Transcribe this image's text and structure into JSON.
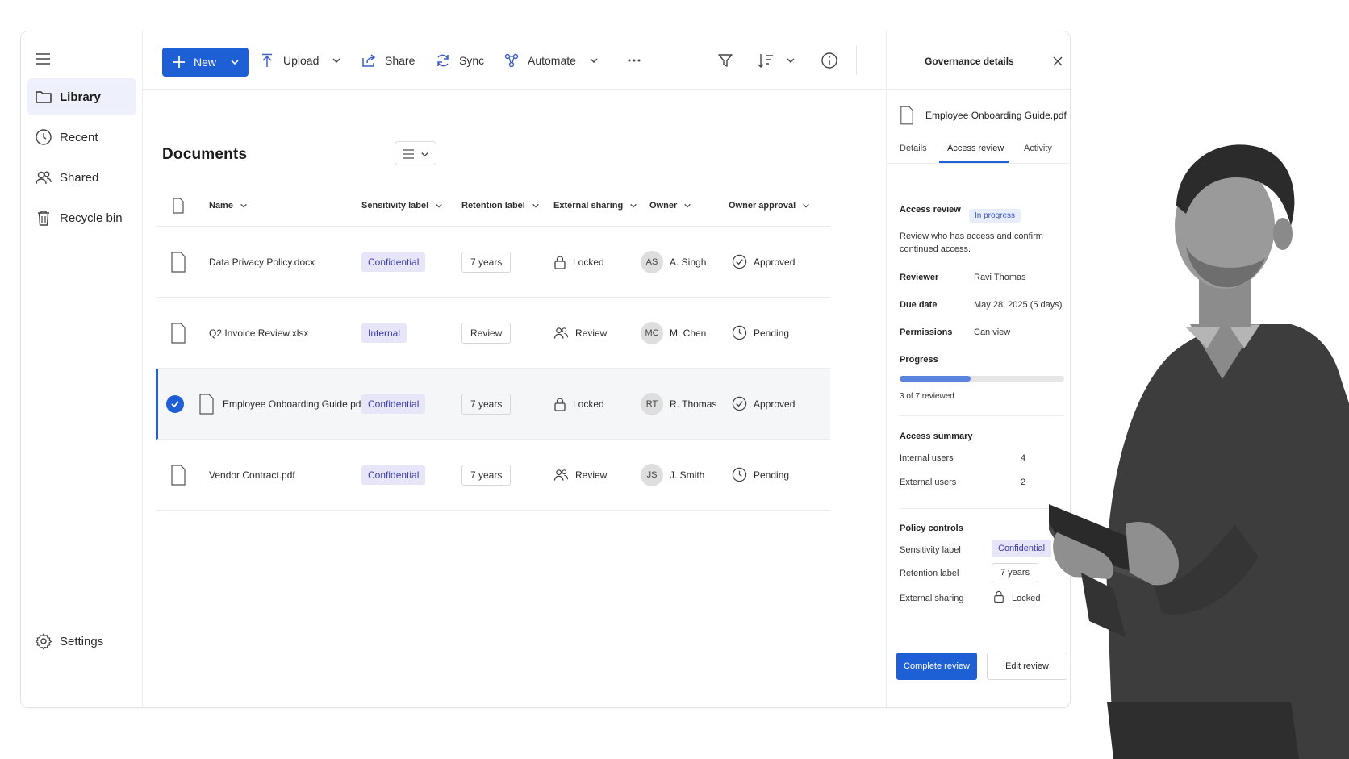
{
  "sidebar": {
    "items": [
      {
        "label": "Library",
        "icon": "folder-icon"
      },
      {
        "label": "Recent",
        "icon": "clock-icon"
      },
      {
        "label": "Shared",
        "icon": "people-icon"
      },
      {
        "label": "Recycle bin",
        "icon": "trash-icon"
      }
    ],
    "settings_label": "Settings"
  },
  "toolbar": {
    "new_label": "New",
    "upload_label": "Upload",
    "share_label": "Share",
    "sync_label": "Sync",
    "automate_label": "Automate"
  },
  "main": {
    "title": "Documents",
    "columns": [
      "Name",
      "Sensitivity label",
      "Retention label",
      "External sharing",
      "Owner",
      "Owner approval"
    ],
    "rows": [
      {
        "name": "Data Privacy Policy.docx",
        "sensitivity": "Confidential",
        "retention": "7 years",
        "sharing": "Locked",
        "owner_initials": "AS",
        "owner": "A. Singh",
        "approval": "Approved",
        "selected": false
      },
      {
        "name": "Q2 Invoice Review.xlsx",
        "sensitivity": "Internal",
        "retention": "Review",
        "sharing": "Review",
        "owner_initials": "MC",
        "owner": "M. Chen",
        "approval": "Pending",
        "selected": false
      },
      {
        "name": "Employee Onboarding Guide.pdf",
        "sensitivity": "Confidential",
        "retention": "7 years",
        "sharing": "Locked",
        "owner_initials": "RT",
        "owner": "R. Thomas",
        "approval": "Approved",
        "selected": true
      },
      {
        "name": "Vendor Contract.pdf",
        "sensitivity": "Confidential",
        "retention": "7 years",
        "sharing": "Review",
        "owner_initials": "JS",
        "owner": "J. Smith",
        "approval": "Pending",
        "selected": false
      }
    ]
  },
  "panel": {
    "title": "Governance details",
    "file_name": "Employee Onboarding Guide.pdf",
    "tabs": [
      "Details",
      "Access review",
      "Activity"
    ],
    "active_tab": "Access review",
    "section_title": "Access review",
    "status_badge": "In progress",
    "description": "Review who has access and confirm continued access.",
    "reviewer_label": "Reviewer",
    "reviewer": "Ravi Thomas",
    "due_label": "Due date",
    "due": "May 28, 2025 (5 days)",
    "permissions_label": "Permissions",
    "permissions": "Can view",
    "progress_label": "Progress",
    "progress_fraction": 0.43,
    "progress_text": "3 of 7 reviewed",
    "summary_title": "Access summary",
    "internal_label": "Internal users",
    "internal_count": "4",
    "external_label": "External users",
    "external_count": "2",
    "policy_title": "Policy controls",
    "sensitivity_label": "Sensitivity label",
    "sensitivity_value": "Confidential",
    "retention_label": "Retention label",
    "retention_value": "7 years",
    "sharing_label": "External sharing",
    "sharing_value": "Locked",
    "complete_button": "Complete review",
    "edit_button": "Edit review"
  },
  "colors": {
    "accent": "#1f5fd6",
    "sensitivity_bg": "#e7e6f8",
    "progress": "#5b84e0"
  }
}
